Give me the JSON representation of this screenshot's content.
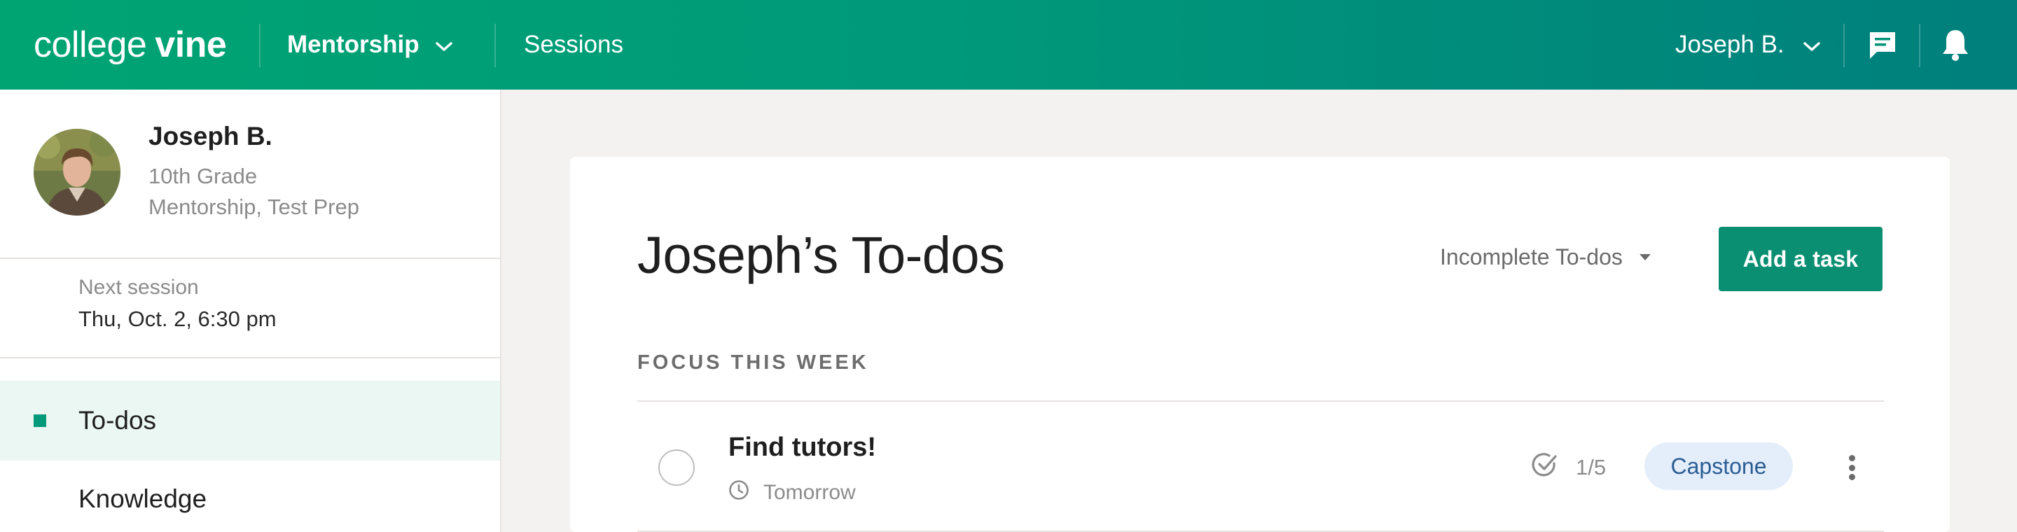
{
  "header": {
    "logo_light": "college",
    "logo_bold": "vine",
    "nav_mentorship": "Mentorship",
    "nav_sessions": "Sessions",
    "user_name": "Joseph B.",
    "icons": [
      "chevron-down-icon",
      "message-icon",
      "bell-icon"
    ]
  },
  "sidebar": {
    "profile": {
      "name": "Joseph B.",
      "grade": "10th Grade",
      "programs": "Mentorship, Test Prep"
    },
    "next_session": {
      "label": "Next session",
      "value": "Thu, Oct. 2, 6:30 pm"
    },
    "nav": [
      {
        "label": "To-dos",
        "active": true
      },
      {
        "label": "Knowledge",
        "active": false
      }
    ]
  },
  "main": {
    "title": "Joseph’s To-dos",
    "filter": "Incomplete To-dos",
    "add_button": "Add a task",
    "section_label": "FOCUS THIS WEEK",
    "tasks": [
      {
        "title": "Find tutors!",
        "due": "Tomorrow",
        "progress": "1/5",
        "tag": "Capstone"
      }
    ]
  },
  "colors": {
    "header_start": "#00a472",
    "header_end": "#007f7c",
    "accent": "#0b8f73",
    "active_nav_bg": "#ebf7f2",
    "tag_bg": "#e4eefb",
    "tag_text": "#2b5d93"
  }
}
